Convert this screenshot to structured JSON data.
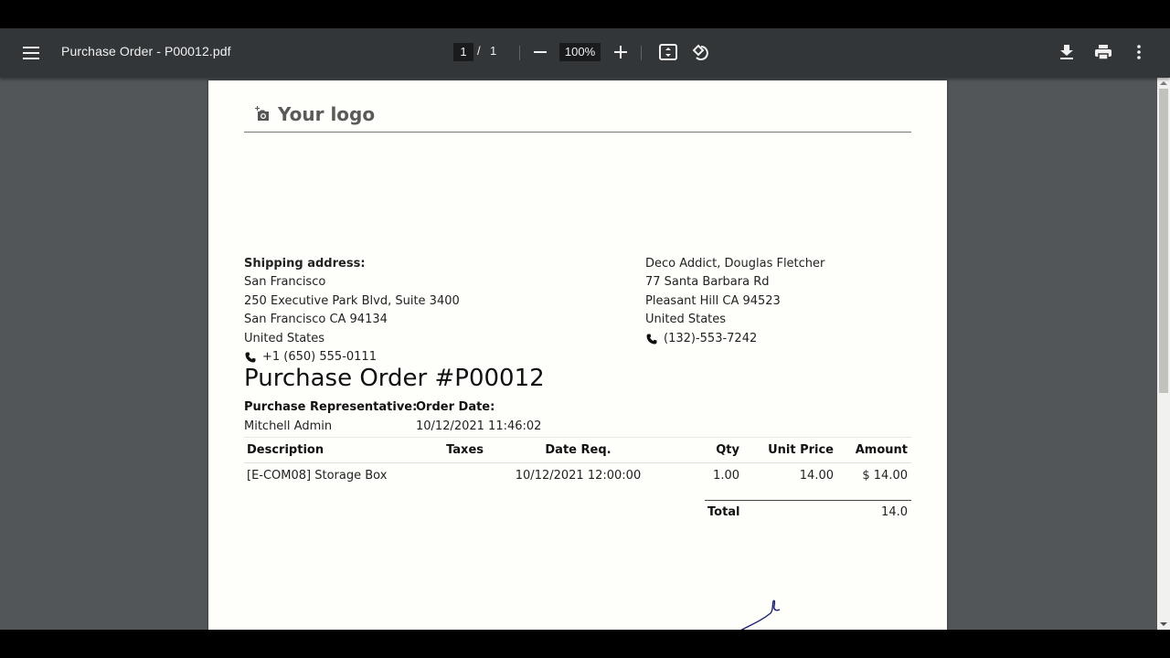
{
  "toolbar": {
    "title": "Purchase Order - P00012.pdf",
    "current_page": "1",
    "page_separator": "/",
    "total_pages": "1",
    "zoom_level": "100%",
    "icons": {
      "menu": "menu-icon",
      "zoom_out": "minus-icon",
      "zoom_in": "plus-icon",
      "fit": "fit-to-page-icon",
      "rotate": "rotate-icon",
      "download": "download-icon",
      "print": "print-icon",
      "more": "more-vert-icon"
    }
  },
  "document": {
    "logo_text": "Your logo",
    "shipping": {
      "label": "Shipping address:",
      "lines": [
        "San Francisco",
        "250 Executive Park Blvd, Suite 3400",
        "San Francisco CA 94134",
        "United States"
      ],
      "phone": "+1 (650) 555-0111"
    },
    "vendor": {
      "lines": [
        "Deco Addict, Douglas Fletcher",
        "77 Santa Barbara Rd",
        "Pleasant Hill CA 94523",
        "United States"
      ],
      "phone": "(132)-553-7242"
    },
    "title": "Purchase Order #P00012",
    "representative_label": "Purchase Representative:",
    "representative": "Mitchell Admin",
    "order_date_label": "Order Date:",
    "order_date": "10/12/2021 11:46:02",
    "table": {
      "headers": [
        "Description",
        "Taxes",
        "Date Req.",
        "Qty",
        "Unit Price",
        "Amount"
      ],
      "rows": [
        [
          "[E-COM08] Storage Box",
          "",
          "10/12/2021 12:00:00",
          "1.00",
          "14.00",
          "$ 14.00"
        ]
      ]
    },
    "total_label": "Total",
    "total_value": "14.0"
  },
  "colors": {
    "toolbar_bg": "#323639",
    "viewer_bg": "#525659",
    "page_bg": "#fefefb",
    "signature_ink": "#1a1f6b"
  }
}
